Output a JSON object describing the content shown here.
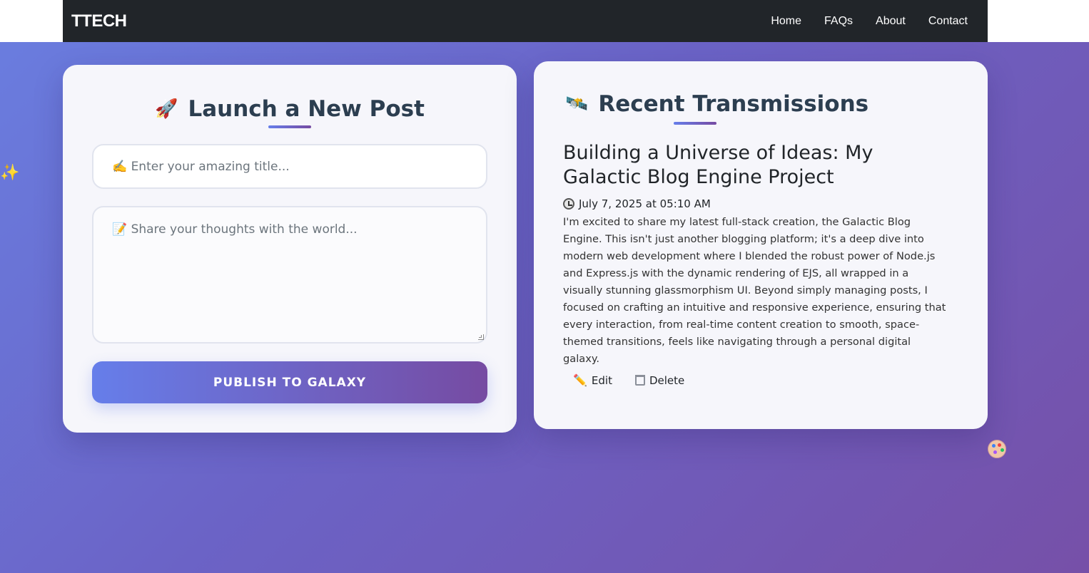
{
  "navbar": {
    "brand": "TTECH",
    "links": [
      "Home",
      "FAQs",
      "About",
      "Contact"
    ]
  },
  "composer": {
    "title": "Launch a New Post",
    "title_icon": "rocket-icon",
    "title_placeholder": "✍️ Enter your amazing title...",
    "body_placeholder": "📝 Share your thoughts with the world...",
    "publish_label": "PUBLISH TO GALAXY"
  },
  "feed": {
    "title": "Recent Transmissions",
    "title_icon": "satellite-icon",
    "posts": [
      {
        "title": "Building a Universe of Ideas: My Galactic Blog Engine Project",
        "date": "July 7, 2025 at 05:10 AM",
        "body": "I'm excited to share my latest full-stack creation, the Galactic Blog Engine. This isn't just another blogging platform; it's a deep dive into modern web development where I blended the robust power of Node.js and Express.js with the dynamic rendering of EJS, all wrapped in a visually stunning glassmorphism UI. Beyond simply managing posts, I focused on crafting an intuitive and responsive experience, ensuring that every interaction, from real-time content creation to smooth, space-themed transitions, feels like navigating through a personal digital galaxy.",
        "edit_label": "Edit",
        "delete_label": "Delete"
      }
    ]
  },
  "colors": {
    "navbar_bg": "#212529",
    "accent_start": "#667eea",
    "accent_end": "#764ba2",
    "card_bg": "#f6f6fb"
  }
}
